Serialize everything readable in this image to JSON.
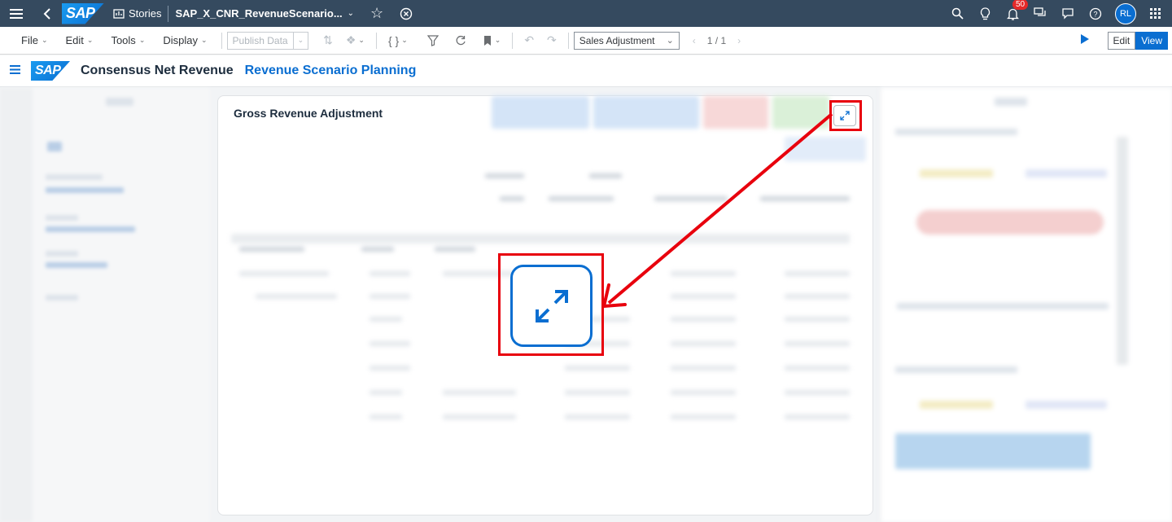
{
  "shell": {
    "brand": "SAP",
    "stories_label": "Stories",
    "story_title": "SAP_X_CNR_RevenueScenario...",
    "notification_count": "50",
    "avatar_initials": "RL"
  },
  "toolbar": {
    "menus": [
      "File",
      "Edit",
      "Tools",
      "Display"
    ],
    "publish_label": "Publish Data",
    "curly_label": "{ }",
    "version_select": "Sales Adjustment",
    "pager": "1 / 1",
    "edit_label": "Edit",
    "view_label": "View"
  },
  "header": {
    "brand": "SAP",
    "title": "Consensus Net Revenue",
    "subtitle": "Revenue Scenario Planning"
  },
  "card": {
    "title": "Gross Revenue Adjustment"
  },
  "colors": {
    "shell_bg": "#354a5f",
    "accent": "#0a6ed1",
    "highlight": "#e8000d"
  }
}
